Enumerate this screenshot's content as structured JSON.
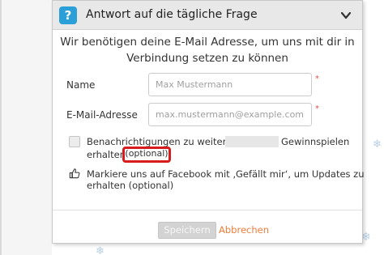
{
  "dialog": {
    "title": "Antwort auf die tägliche Frage",
    "help_icon": "question-icon",
    "collapse_icon": "chevron-down-icon",
    "intro_line1": "Wir benötigen deine E-Mail Adresse, um uns mit dir in",
    "intro_line2": "Verbindung setzen zu können"
  },
  "form": {
    "name_label": "Name",
    "name_placeholder": "Max Mustermann",
    "email_label": "E-Mail-Adresse",
    "email_placeholder": "max.mustermann@example.com",
    "required_marker": "*",
    "newsletter_part1": "Benachrichtigungen zu weiteren",
    "newsletter_part2": "Gewinnspielen",
    "newsletter_part3": "erhalten",
    "newsletter_optional": "(optional)",
    "newsletter_checked": false,
    "facebook_icon": "thumbs-up-icon",
    "facebook_line1": "Markiere uns auf Facebook mit ‚Gefällt mir‘, um Updates zu",
    "facebook_line2": "erhalten (optional)"
  },
  "actions": {
    "save_label": "Speichern",
    "cancel_label": "Abbrechen"
  },
  "colors": {
    "accent_blue": "#2a9fd8",
    "cancel_orange": "#f07d39",
    "highlight_red": "#d61c1c",
    "required_red": "#d9534f"
  }
}
